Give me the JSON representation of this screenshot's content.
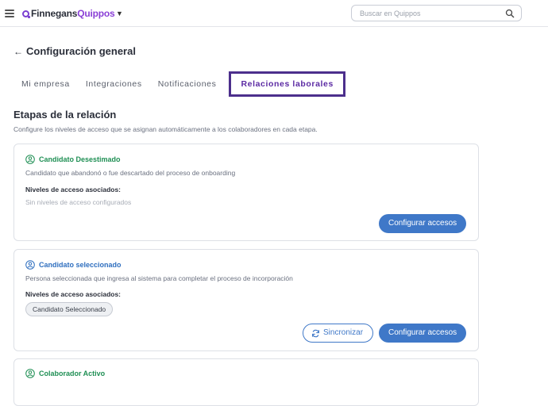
{
  "header": {
    "logo_part1": "Finnegans",
    "logo_part2": "Quippos",
    "search_placeholder": "Buscar en Quippos"
  },
  "page": {
    "back_arrow": "←",
    "title": "Configuración general"
  },
  "tabs": [
    {
      "label": "Mi empresa",
      "active": false
    },
    {
      "label": "Integraciones",
      "active": false
    },
    {
      "label": "Notificaciones",
      "active": false
    },
    {
      "label": "Relaciones laborales",
      "active": true
    }
  ],
  "section": {
    "title": "Etapas de la relación",
    "description": "Configure los niveles de acceso que se asignan automáticamente a los colaboradores en cada etapa."
  },
  "cards": [
    {
      "title": "Candidato Desestimado",
      "title_color": "#1f8f54",
      "description": "Candidato que abandonó o fue descartado del proceso de onboarding",
      "levels_label": "Niveles de acceso asociados:",
      "empty_text": "Sin niveles de acceso configurados",
      "configure_label": "Configurar accesos"
    },
    {
      "title": "Candidato seleccionado",
      "title_color": "#2f6fbf",
      "description": "Persona seleccionada que ingresa al sistema para completar el proceso de incorporación",
      "levels_label": "Niveles de acceso asociados:",
      "chip": "Candidato Seleccionado",
      "sync_label": "Sincronizar",
      "configure_label": "Configurar accesos"
    },
    {
      "title": "Colaborador Activo",
      "title_color": "#1f8f54"
    }
  ]
}
